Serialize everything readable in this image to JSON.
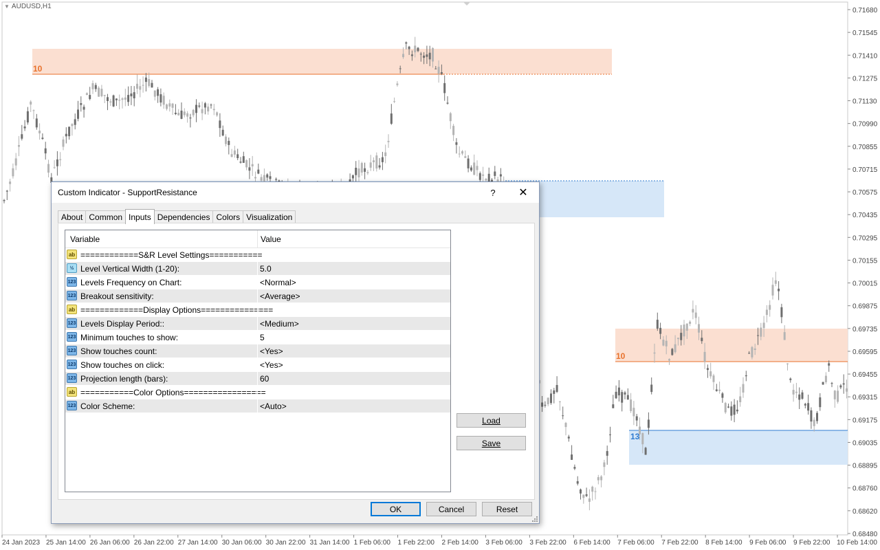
{
  "chart": {
    "symbol": "AUDUSD,H1",
    "price_labels": [
      "0.71680",
      "0.71545",
      "0.71410",
      "0.71275",
      "0.71130",
      "0.70990",
      "0.70855",
      "0.70715",
      "0.70575",
      "0.70435",
      "0.70295",
      "0.70155",
      "0.70015",
      "0.69875",
      "0.69735",
      "0.69595",
      "0.69455",
      "0.69315",
      "0.69175",
      "0.69035",
      "0.68895",
      "0.68760",
      "0.68620",
      "0.68480"
    ],
    "time_labels": [
      "24 Jan 2023",
      "25 Jan 14:00",
      "26 Jan 06:00",
      "26 Jan 22:00",
      "27 Jan 14:00",
      "30 Jan 06:00",
      "30 Jan 22:00",
      "31 Jan 14:00",
      "1 Feb 06:00",
      "1 Feb 22:00",
      "2 Feb 14:00",
      "3 Feb 06:00",
      "3 Feb 22:00",
      "6 Feb 14:00",
      "7 Feb 06:00",
      "7 Feb 22:00",
      "8 Feb 14:00",
      "9 Feb 06:00",
      "9 Feb 22:00",
      "10 Feb 14:00"
    ],
    "zone_labels": {
      "upper_left": "10",
      "upper_right": "10",
      "lower_right": "13"
    },
    "colors": {
      "resistance_zone": "#fbdfd1",
      "resistance_line": "#e8722c",
      "support_zone": "#d6e7f8",
      "support_line": "#2f7bd0",
      "candle_light": "#b4b4b4",
      "candle_dark": "#6e6e6e"
    }
  },
  "dialog": {
    "title": "Custom Indicator - SupportResistance",
    "help": "?",
    "close": "✕",
    "tabs": [
      "About",
      "Common",
      "Inputs",
      "Dependencies",
      "Colors",
      "Visualization"
    ],
    "active_tab": "Inputs",
    "grid": {
      "col_variable": "Variable",
      "col_value": "Value",
      "rows": [
        {
          "icon": "ab",
          "variable": "============S&R Level Settings===========",
          "value": ""
        },
        {
          "icon": "frac",
          "variable": "Level Vertical Width (1-20):",
          "value": "5.0"
        },
        {
          "icon": "num",
          "variable": "Levels Frequency on Chart:",
          "value": "<Normal>"
        },
        {
          "icon": "num",
          "variable": "Breakout sensitivity:",
          "value": "<Average>"
        },
        {
          "icon": "ab",
          "variable": "=============Display Options===============",
          "value": ""
        },
        {
          "icon": "num",
          "variable": "Levels Display Period::",
          "value": "<Medium>"
        },
        {
          "icon": "num",
          "variable": "Minimum touches to show:",
          "value": "5"
        },
        {
          "icon": "num",
          "variable": "Show touches count:",
          "value": "<Yes>"
        },
        {
          "icon": "num",
          "variable": "Show touches on click:",
          "value": "<Yes>"
        },
        {
          "icon": "num",
          "variable": "Projection length (bars):",
          "value": "60"
        },
        {
          "icon": "ab",
          "variable": "===========Color Options=================",
          "value": ""
        },
        {
          "icon": "num",
          "variable": "Color Scheme:",
          "value": "<Auto>"
        }
      ]
    },
    "icon_text": {
      "ab": "ab",
      "num": "123",
      "frac": "½"
    },
    "buttons": {
      "load": "Load",
      "save": "Save",
      "ok": "OK",
      "cancel": "Cancel",
      "reset": "Reset"
    }
  }
}
